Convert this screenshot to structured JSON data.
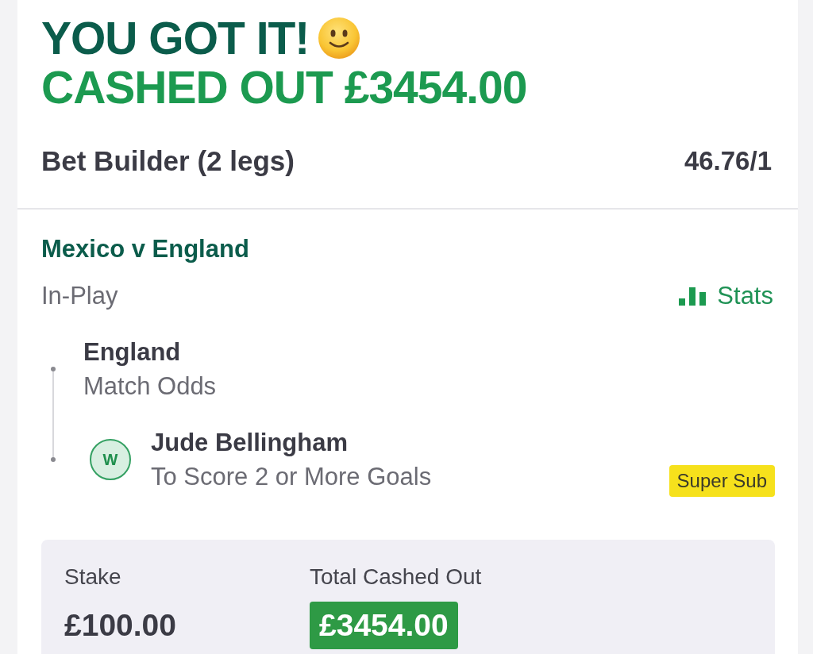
{
  "header": {
    "title": "YOU GOT IT!",
    "subtitle": "CASHED OUT £3454.00"
  },
  "bet": {
    "type": "Bet Builder (2 legs)",
    "odds": "46.76/1"
  },
  "event": {
    "name": "Mexico v England",
    "status": "In-Play",
    "stats_link": "Stats"
  },
  "legs": [
    {
      "selection": "England",
      "market": "Match Odds"
    },
    {
      "selection": "Jude Bellingham",
      "market": "To Score 2 or More Goals",
      "result": "W",
      "tag": "Super Sub"
    }
  ],
  "summary": {
    "stake_label": "Stake",
    "stake": "£100.00",
    "cashout_label": "Total Cashed Out",
    "cashout": "£3454.00"
  }
}
